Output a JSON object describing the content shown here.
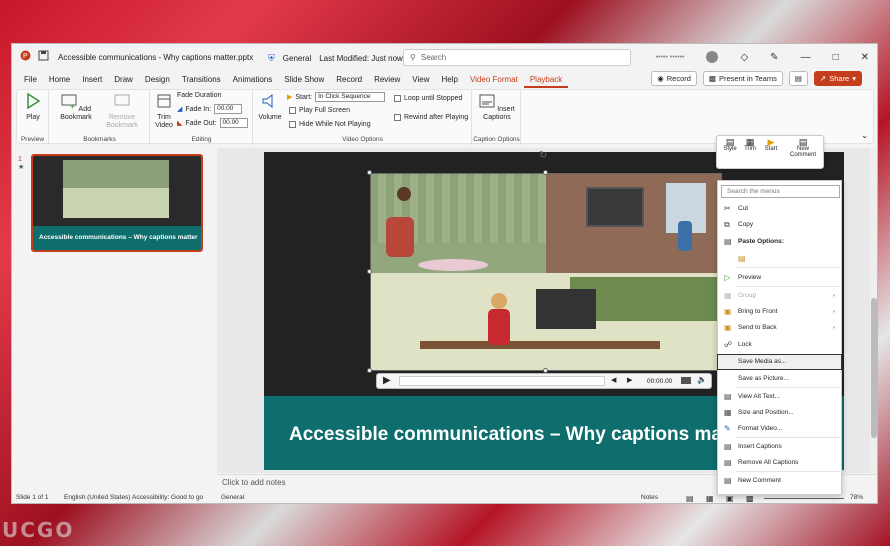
{
  "window": {
    "title": "Accessible communications - Why captions matter.pptx",
    "sensitivity": "General",
    "modified": "Last Modified: Just now",
    "user_name": "••••• ••••••"
  },
  "search": {
    "placeholder": "Search"
  },
  "menu": {
    "tabs": [
      "File",
      "Home",
      "Insert",
      "Draw",
      "Design",
      "Transitions",
      "Animations",
      "Slide Show",
      "Record",
      "Review",
      "View",
      "Help",
      "Video Format",
      "Playback"
    ]
  },
  "actions": {
    "record": "Record",
    "present": "Present in Teams",
    "share": "Share"
  },
  "ribbon": {
    "preview": {
      "play": "Play",
      "label": "Preview"
    },
    "bookmarks": {
      "add": "Add Bookmark",
      "remove": "Remove Bookmark",
      "label": "Bookmarks"
    },
    "editing": {
      "trim": "Trim Video",
      "fade_duration": "Fade Duration",
      "fade_in": "Fade In:",
      "fade_in_val": "00.00",
      "fade_out": "Fade Out:",
      "fade_out_val": "00.00",
      "label": "Editing"
    },
    "video_options": {
      "volume": "Volume",
      "start": "Start:",
      "start_val": "In Click Sequence",
      "play_full": "Play Full Screen",
      "hide": "Hide While Not Playing",
      "loop": "Loop until Stopped",
      "rewind": "Rewind after Playing",
      "label": "Video Options"
    },
    "caption": {
      "insert": "Insert Captions",
      "label": "Caption Options"
    }
  },
  "thumbnail": {
    "number": "1",
    "star": "★",
    "caption": "Accessible communications – Why captions matter"
  },
  "slide": {
    "title": "Accessible communications – Why captions matter",
    "time": "00:00.00"
  },
  "notes": "Click to add notes",
  "status": {
    "slide": "Slide 1 of 1",
    "language": "English (United States)",
    "accessibility": "Accessibility: Good to go",
    "sensitivity": "General",
    "notes": "Notes",
    "zoom": "78%"
  },
  "mini_toolbar": {
    "style": "Style",
    "trim": "Trim",
    "start": "Start",
    "comment": "New Comment"
  },
  "context_menu": {
    "search": "Search the menus",
    "items": [
      "Cut",
      "Copy",
      "Paste Options:",
      "Preview",
      "Group",
      "Bring to Front",
      "Send to Back",
      "Lock",
      "Save Media as...",
      "Save as Picture...",
      "View Alt Text...",
      "Size and Position...",
      "Format Video...",
      "Insert Captions",
      "Remove All Captions",
      "New Comment"
    ]
  },
  "colors": {
    "accent": "#c43e1c",
    "teal": "#0e6e6e"
  }
}
